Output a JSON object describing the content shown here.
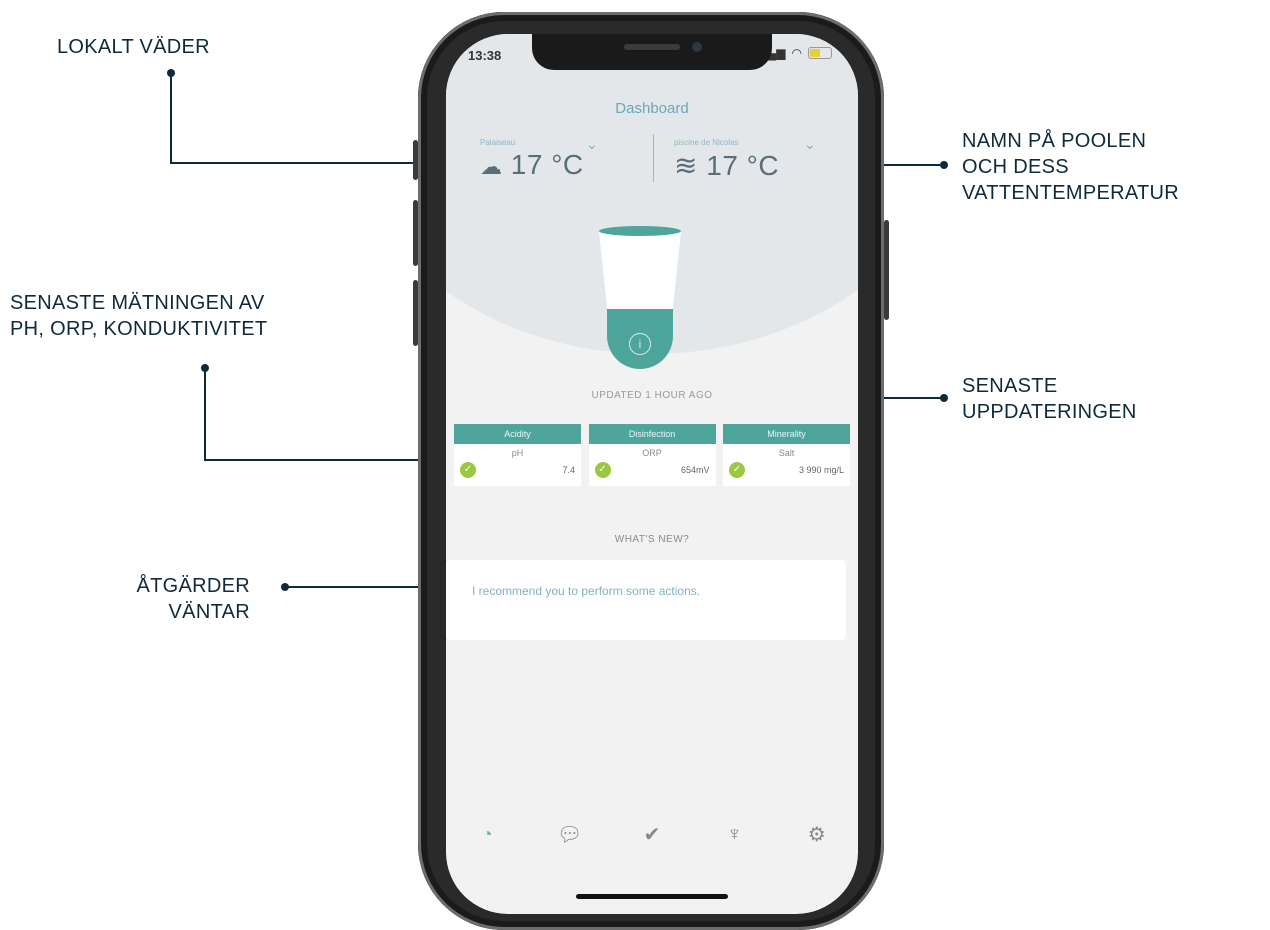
{
  "annotations": {
    "local_weather": "LOKALT VÄDER",
    "pool_name_1": "NAMN PÅ POOLEN",
    "pool_name_2": "OCH DESS",
    "pool_name_3": "VATTENTEMPERATUR",
    "latest_measure_1": "SENASTE MÄTNINGEN AV",
    "latest_measure_2": "PH, ORP, KONDUKTIVITET",
    "latest_update_1": "SENASTE",
    "latest_update_2": "UPPDATERINGEN",
    "actions_1": "ÅTGÄRDER",
    "actions_2": "VÄNTAR"
  },
  "status_bar": {
    "time": "13:38"
  },
  "header": {
    "title": "Dashboard"
  },
  "weather": {
    "location": "Palaiseau",
    "temperature": "17 °C",
    "icon": "cloud-rain-icon"
  },
  "pool": {
    "name": "piscine de Nicolas",
    "temperature": "17 °C",
    "icon": "water-waves-icon"
  },
  "updated": "UPDATED 1 HOUR AGO",
  "cards": [
    {
      "header": "Acidity",
      "label": "pH",
      "value": "7.4",
      "status": "ok"
    },
    {
      "header": "Disinfection",
      "label": "ORP",
      "value": "654mV",
      "status": "ok"
    },
    {
      "header": "Minerality",
      "label": "Salt",
      "value": "3 990 mg/L",
      "status": "ok"
    }
  ],
  "whats_new": "WHAT'S NEW?",
  "message": "I recommend you to perform some actions.",
  "tabs": [
    {
      "icon": "gauge-icon",
      "active": true
    },
    {
      "icon": "chat-icon",
      "active": false
    },
    {
      "icon": "check-icon",
      "active": false
    },
    {
      "icon": "lightbulb-icon",
      "active": false
    },
    {
      "icon": "gear-icon",
      "active": false
    }
  ],
  "colors": {
    "accent": "#4ea59b",
    "ok": "#9ac93f",
    "annotation": "#0f2a3a"
  }
}
